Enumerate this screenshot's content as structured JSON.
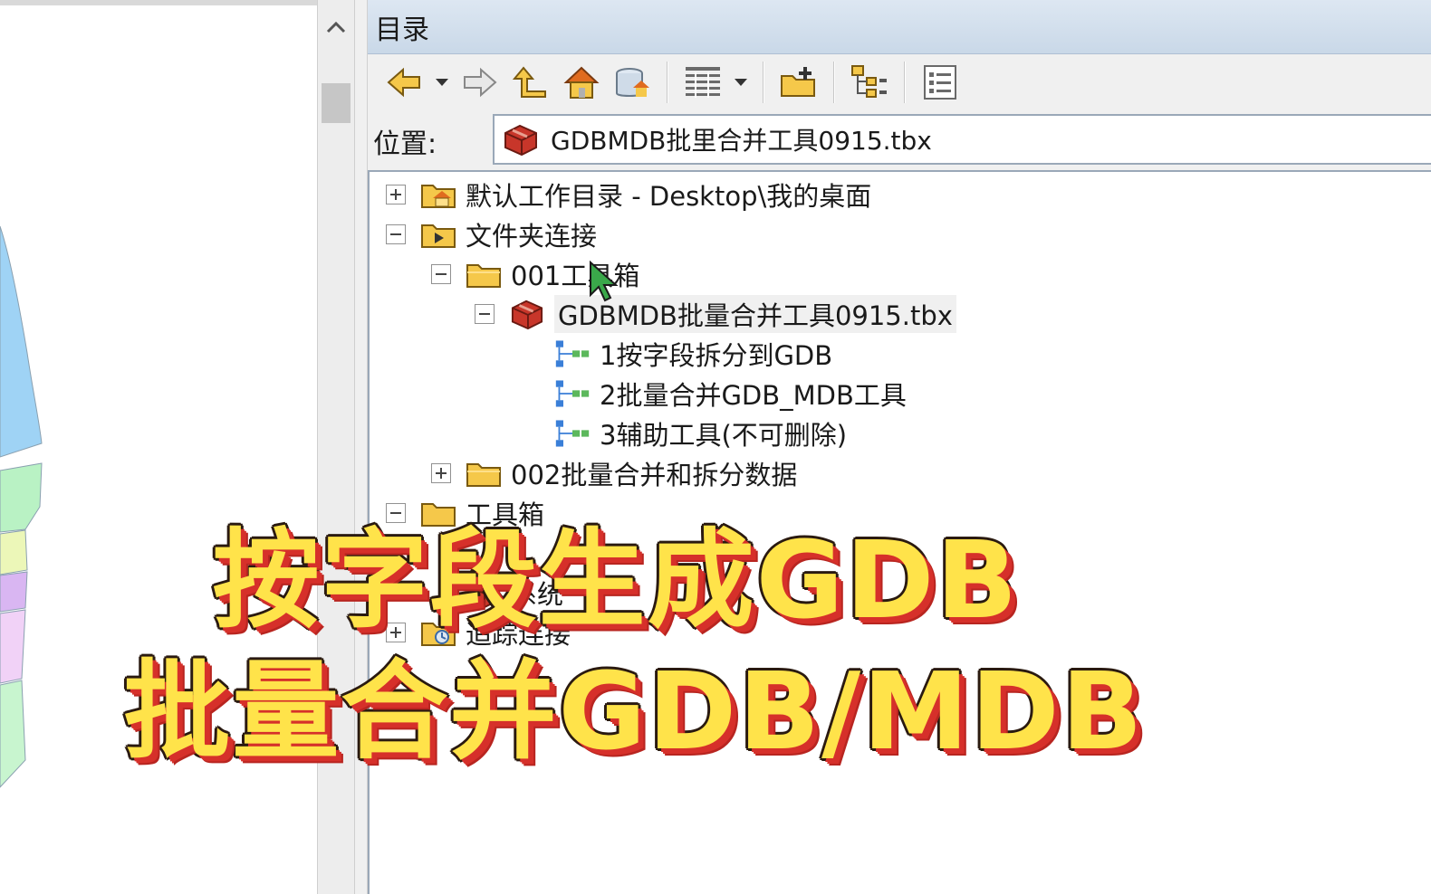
{
  "catalog": {
    "title": "目录",
    "location_label": "位置:",
    "location_value": "GDBMDB批里合并工具0915.tbx"
  },
  "toolbar": {
    "buttons": [
      "back-arrow-icon",
      "forward-arrow-icon",
      "up-folder-icon",
      "home-icon",
      "database-home-icon",
      "list-view-icon",
      "connect-folder-icon",
      "tree-view-icon",
      "options-icon"
    ]
  },
  "tree": {
    "items": [
      {
        "label": "默认工作目录 - Desktop\\我的桌面",
        "expander": "plus",
        "icon": "home-folder-icon",
        "level": 0
      },
      {
        "label": "文件夹连接",
        "expander": "minus",
        "icon": "folder-connection-icon",
        "level": 0
      },
      {
        "label": "001工具箱",
        "expander": "minus",
        "icon": "folder-icon",
        "level": 1
      },
      {
        "label": "GDBMDB批量合并工具0915.tbx",
        "expander": "minus",
        "icon": "toolbox-icon",
        "level": 2
      },
      {
        "label": "1按字段拆分到GDB",
        "icon": "model-tool-icon",
        "level": 3
      },
      {
        "label": "2批量合并GDB_MDB工具",
        "icon": "model-tool-icon",
        "level": 3
      },
      {
        "label": "3辅助工具(不可删除)",
        "icon": "model-tool-icon",
        "level": 3
      },
      {
        "label": "002批量合并和拆分数据",
        "expander": "plus",
        "icon": "folder-icon",
        "level": 1
      },
      {
        "label": "工具箱",
        "expander": "minus",
        "icon": "folder-icon",
        "level": 0
      },
      {
        "label": "系统",
        "icon": "toolbox-icon",
        "level": 1
      },
      {
        "label": "追踪连接",
        "expander": "plus",
        "icon": "tracking-connection-icon",
        "level": 0
      }
    ]
  },
  "caption": {
    "line1": "按字段生成GDB",
    "line2": "批量合并GDB/MDB"
  },
  "colors": {
    "caption_fill": "#ffe34a",
    "caption_shadow": "#d6302a",
    "title_bar": "#c9d8e8"
  }
}
